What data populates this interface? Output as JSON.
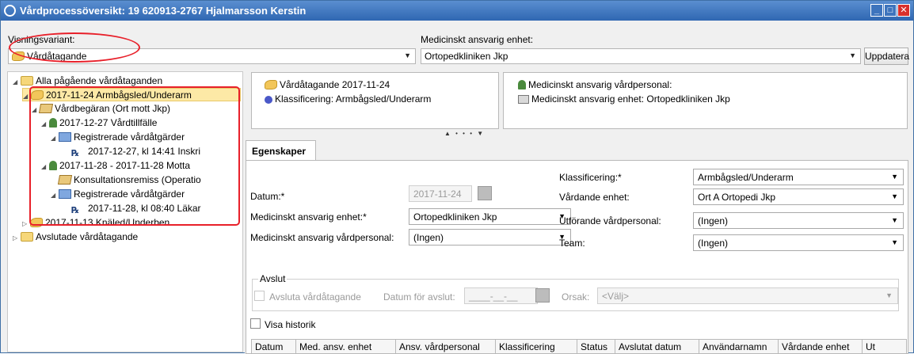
{
  "window": {
    "title": "Vårdprocessöversikt: 19 620913-2767 Hjalmarsson Kerstin",
    "min": "_",
    "max": "□",
    "close": "✕"
  },
  "toolbar": {
    "view_label": "Visningsvariant:",
    "view_value": "Vårdåtagande",
    "unit_label": "Medicinskt ansvarig enhet:",
    "unit_value": "Ortopedkliniken Jkp",
    "update_button": "Uppdatera"
  },
  "tree": {
    "root": "Alla pågående vårdåtaganden",
    "n1": "2017-11-24  Armbågsled/Underarm",
    "n2": "Vårdbegäran (Ort mott Jkp)",
    "n3": "2017-12-27  Vårdtillfälle",
    "n4": "Registrerade vårdåtgärder",
    "n5": "2017-12-27, kl 14:41  Inskri",
    "n6": "2017-11-28  -  2017-11-28  Motta",
    "n7": "Konsultationsremiss (Operatio",
    "n8": "Registrerade vårdåtgärder",
    "n9": "2017-11-28, kl 08:40  Läkar",
    "n10": "2017-11-13  Knäled/Underben",
    "n11": "Avslutade vårdåtagande"
  },
  "summary": {
    "care_commitment": "Vårdåtagande 2017-11-24",
    "classification": "Klassificering: Armbågsled/Underarm",
    "med_staff": "Medicinskt ansvarig vårdpersonal:",
    "med_unit": "Medicinskt ansvarig enhet: Ortopedkliniken Jkp",
    "splitter": "▲ • • • ▼"
  },
  "tab": {
    "label": "Egenskaper"
  },
  "form": {
    "date_label": "Datum:*",
    "date_value": "2017-11-24",
    "unit_label": "Medicinskt ansvarig enhet:*",
    "unit_value": "Ortopedkliniken Jkp",
    "staff_label": "Medicinskt ansvarig vårdpersonal:",
    "staff_value": "(Ingen)",
    "class_label": "Klassificering:*",
    "class_value": "Armbågsled/Underarm",
    "care_unit_label": "Vårdande enhet:",
    "care_unit_value": "Ort A Ortopedi Jkp",
    "exec_staff_label": "Utförande vårdpersonal:",
    "exec_staff_value": "(Ingen)",
    "team_label": "Team:",
    "team_value": "(Ingen)"
  },
  "close_group": {
    "title": "Avslut",
    "checkbox_label": "Avsluta vårdåtagande",
    "date_label": "Datum för avslut:",
    "date_value": "____-__-__",
    "reason_label": "Orsak:",
    "reason_value": "<Välj>"
  },
  "history": {
    "label": "Visa historik"
  },
  "grid": {
    "columns": [
      "Datum",
      "Med. ansv. enhet",
      "Ansv. vårdpersonal",
      "Klassificering",
      "Status",
      "Avslutat datum",
      "Användarnamn",
      "Vårdande enhet",
      "Ut"
    ]
  },
  "icons": {
    "dropdown": "▼",
    "collapse": "◢",
    "expand": "▷",
    "rx": "℞"
  }
}
